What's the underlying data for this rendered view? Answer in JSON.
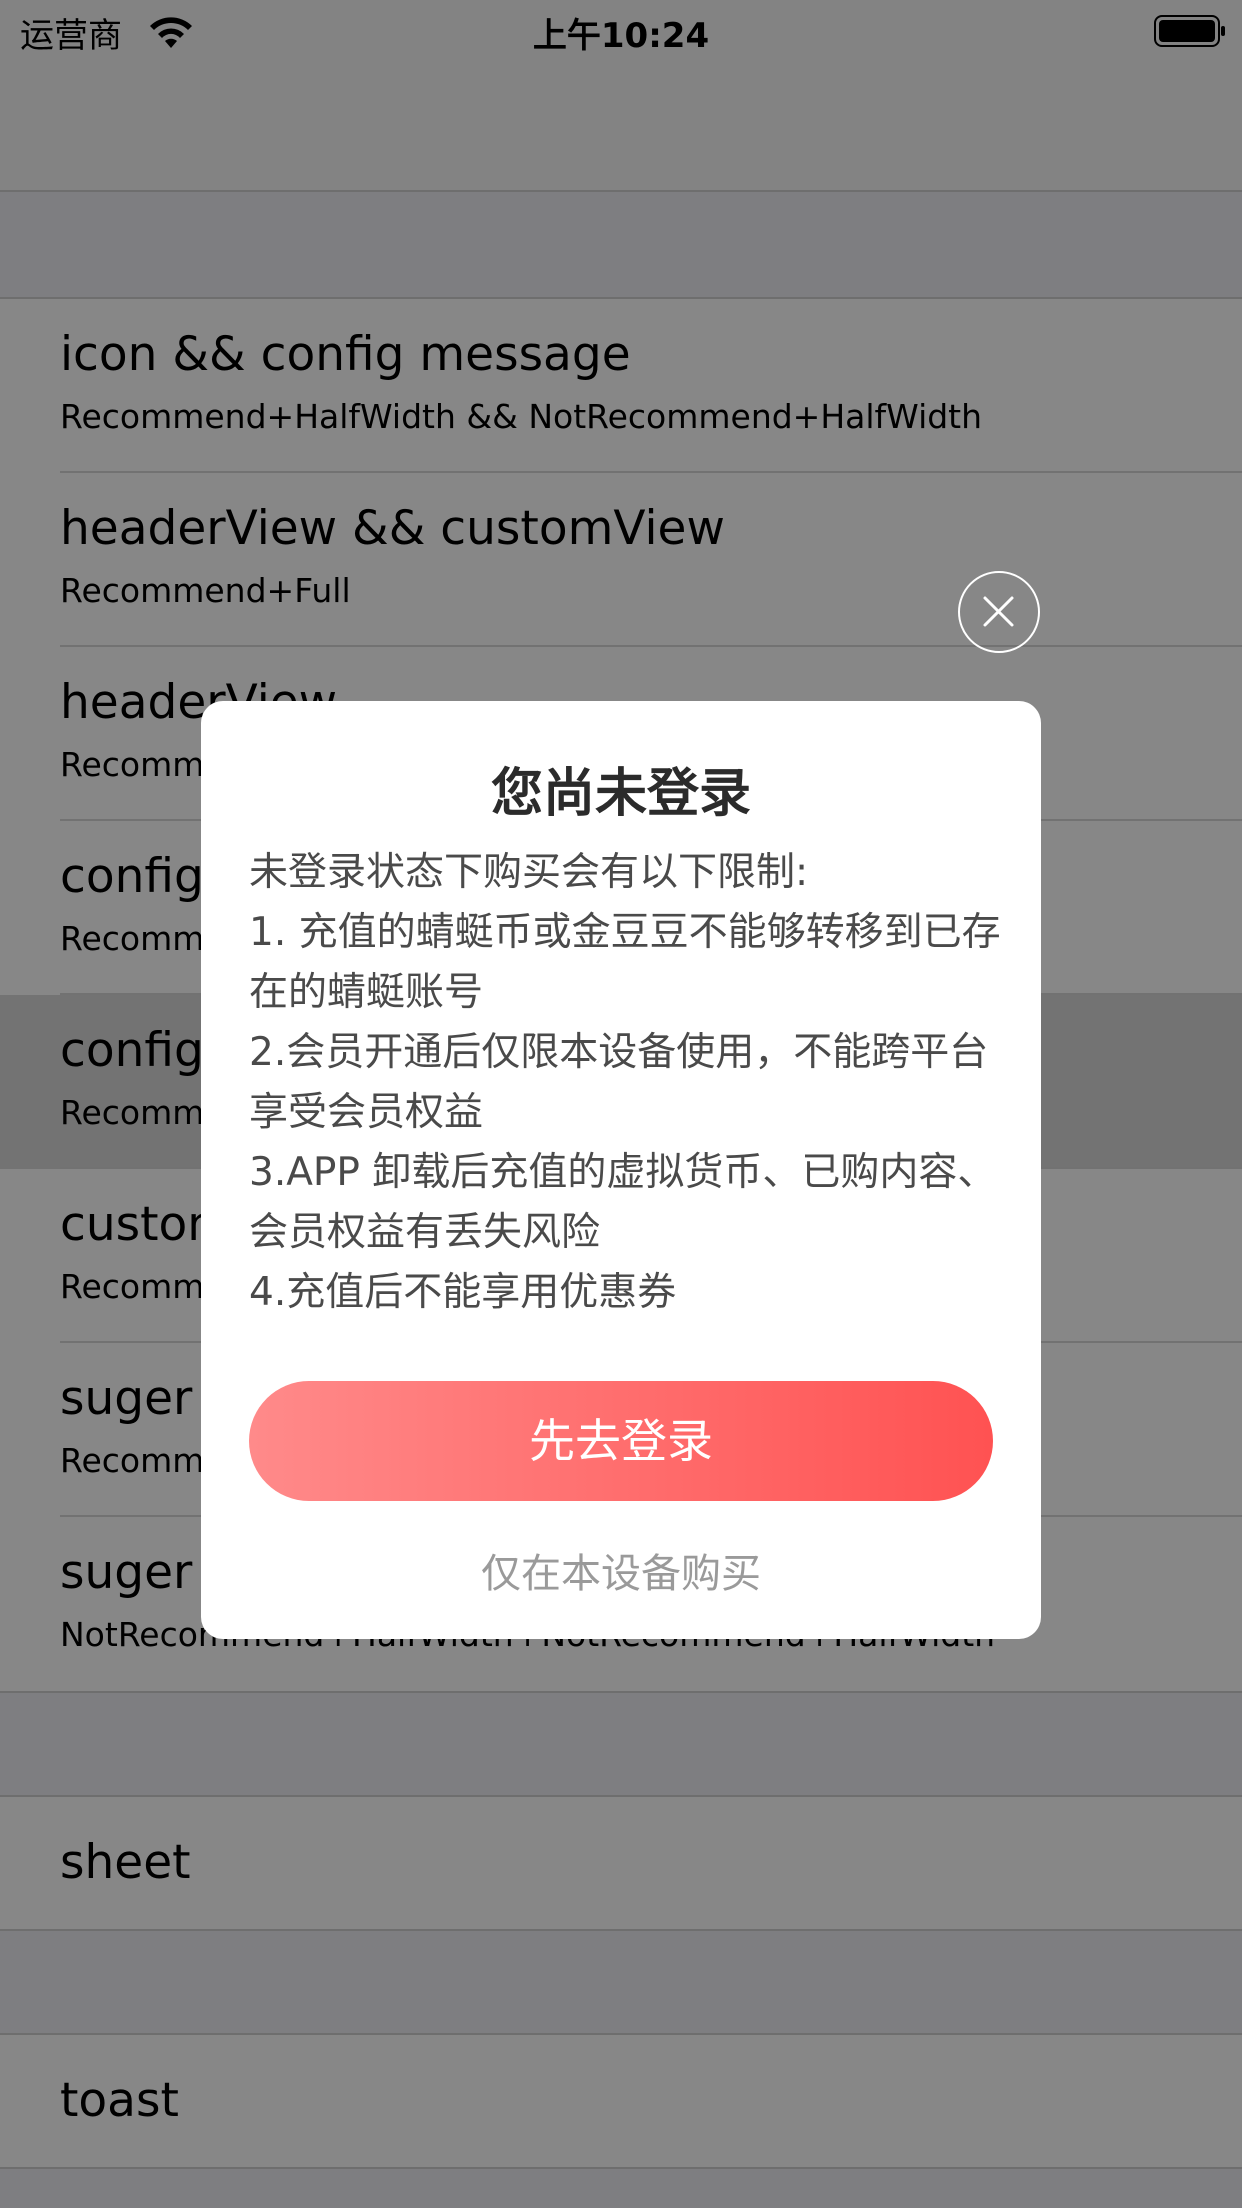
{
  "status_bar": {
    "carrier": "运营商",
    "time": "上午10:24"
  },
  "table": {
    "section1": [
      {
        "title": "icon && config message",
        "subtitle": "Recommend+HalfWidth && NotRecommend+HalfWidth"
      },
      {
        "title": "headerView && customView",
        "subtitle": "Recommend+Full"
      },
      {
        "title": "headerView",
        "subtitle": "Recomm"
      },
      {
        "title": "config",
        "subtitle": "Recomm"
      },
      {
        "title": "config",
        "subtitle": "Recomm",
        "selected": true
      },
      {
        "title": "custon",
        "subtitle": "Recomm"
      },
      {
        "title": "suger",
        "subtitle": "Recomm"
      },
      {
        "title": "suger",
        "subtitle": "NotRecommend+HalfWidth+NotRecommend+HalfWidth"
      }
    ],
    "section2": [
      {
        "title": "sheet"
      }
    ],
    "section3": [
      {
        "title": "toast"
      }
    ]
  },
  "alert": {
    "title": "您尚未登录",
    "lines": [
      "未登录状态下购买会有以下限制:",
      "1. 充值的蜻蜓币或金豆豆不能够转移到已存在的蜻蜓账号",
      "2.会员开通后仅限本设备使用，不能跨平台享受会员权益",
      "3.APP 卸载后充值的虚拟货币、已购内容、会员权益有丢失风险",
      "4.充值后不能享用优惠券"
    ],
    "login_button": "先去登录",
    "device_only_link": "仅在本设备购买"
  },
  "colors": {
    "button_gradient_start": "#ff8a8a",
    "button_gradient_end": "#ff5252",
    "overlay": "rgba(0,0,0,0.47)"
  }
}
